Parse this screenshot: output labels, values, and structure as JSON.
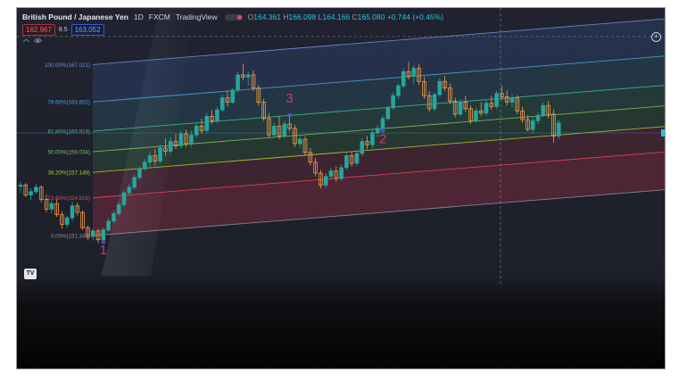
{
  "header": {
    "symbol": "British Pound / Japanese Yen",
    "interval": "1D",
    "source": "FXCM",
    "platform": "TradingView",
    "open_label": "O",
    "open": "164.361",
    "high_label": "H",
    "high": "166.098",
    "low_label": "L",
    "low": "164.166",
    "close_label": "C",
    "close": "165.080",
    "change": "+0.744 (+0.45%)"
  },
  "quote": {
    "bid": "162.967",
    "spread": "8.5",
    "ask": "163.052"
  },
  "icons": {
    "logo": "tradingview-logo-icon",
    "eye": "eye-icon",
    "add": "plus-circle-icon"
  },
  "logo_text": "TV",
  "colors": {
    "bull": "#26a69a",
    "bear": "#f09a4a",
    "wave_label": "#d6336c",
    "fib_100": "#6f8fd6",
    "fib_786": "#4aa3d6",
    "fib_618": "#3fbf8f",
    "fib_50": "#7cc05a",
    "fib_382": "#b6c43a",
    "fib_236": "#e8455a",
    "fib_0": "#8c8f99"
  },
  "chart_data": {
    "type": "candlestick",
    "y_unit": "JPY per GBP",
    "ylim": [
      147.6,
      171.8
    ],
    "fib_channel": {
      "levels": [
        {
          "ratio": "0.00%",
          "price": "151.349"
        },
        {
          "ratio": "23.60%",
          "price": "154.816"
        },
        {
          "ratio": "38.20%",
          "price": "157.149"
        },
        {
          "ratio": "50.00%",
          "price": "159.034"
        },
        {
          "ratio": "61.80%",
          "price": "160.919"
        },
        {
          "ratio": "78.60%",
          "price": "163.602"
        },
        {
          "ratio": "100.00%",
          "price": "167.021"
        }
      ],
      "slope_per_bar": 0.038
    },
    "wave_points": [
      {
        "label": "1",
        "bar": 16
      },
      {
        "label": "2",
        "bar": 70
      },
      {
        "label": "3",
        "bar": 52
      }
    ],
    "candles": [
      [
        155.8,
        156.2,
        155.2,
        155.9
      ],
      [
        155.9,
        156.1,
        154.8,
        155.0
      ],
      [
        155.0,
        155.6,
        154.5,
        155.3
      ],
      [
        155.3,
        156.0,
        155.1,
        155.7
      ],
      [
        155.7,
        155.9,
        154.3,
        154.6
      ],
      [
        154.6,
        155.0,
        153.4,
        153.7
      ],
      [
        153.7,
        154.5,
        153.3,
        154.2
      ],
      [
        154.2,
        154.6,
        153.0,
        153.2
      ],
      [
        153.2,
        153.5,
        151.9,
        152.3
      ],
      [
        152.3,
        153.1,
        152.0,
        152.9
      ],
      [
        152.9,
        154.4,
        152.6,
        154.0
      ],
      [
        154.0,
        154.3,
        153.1,
        153.4
      ],
      [
        153.4,
        153.6,
        151.8,
        152.0
      ],
      [
        152.0,
        152.2,
        150.9,
        151.2
      ],
      [
        151.2,
        151.9,
        150.8,
        151.7
      ],
      [
        151.7,
        151.9,
        150.6,
        150.9
      ],
      [
        150.9,
        152.0,
        150.7,
        151.8
      ],
      [
        151.8,
        152.9,
        151.6,
        152.6
      ],
      [
        152.6,
        153.6,
        152.4,
        153.3
      ],
      [
        153.3,
        154.4,
        153.1,
        154.1
      ],
      [
        154.1,
        155.4,
        153.9,
        155.2
      ],
      [
        155.2,
        156.0,
        155.0,
        155.7
      ],
      [
        155.7,
        156.9,
        155.5,
        156.6
      ],
      [
        156.6,
        157.6,
        156.4,
        157.4
      ],
      [
        157.4,
        158.3,
        157.2,
        158.0
      ],
      [
        158.0,
        158.9,
        157.6,
        158.6
      ],
      [
        158.6,
        159.2,
        157.7,
        158.1
      ],
      [
        158.1,
        159.6,
        157.9,
        159.3
      ],
      [
        159.3,
        160.2,
        158.6,
        159.0
      ],
      [
        159.0,
        160.3,
        158.8,
        159.9
      ],
      [
        159.9,
        160.6,
        159.2,
        159.5
      ],
      [
        159.5,
        160.9,
        159.3,
        160.6
      ],
      [
        160.6,
        161.0,
        159.4,
        159.7
      ],
      [
        159.7,
        160.9,
        159.4,
        160.5
      ],
      [
        160.5,
        161.6,
        160.2,
        161.3
      ],
      [
        161.3,
        162.0,
        160.6,
        160.9
      ],
      [
        160.9,
        162.5,
        160.7,
        162.2
      ],
      [
        162.2,
        162.8,
        161.5,
        161.8
      ],
      [
        161.8,
        163.1,
        161.6,
        162.8
      ],
      [
        162.8,
        164.2,
        162.6,
        163.9
      ],
      [
        163.9,
        164.5,
        163.1,
        163.5
      ],
      [
        163.5,
        164.8,
        163.3,
        164.6
      ],
      [
        164.6,
        166.3,
        164.4,
        166.0
      ],
      [
        166.0,
        167.0,
        165.5,
        165.8
      ],
      [
        165.8,
        166.3,
        165.0,
        166.0
      ],
      [
        166.0,
        166.4,
        164.5,
        164.8
      ],
      [
        164.8,
        165.1,
        163.2,
        163.5
      ],
      [
        163.5,
        163.8,
        161.8,
        162.0
      ],
      [
        162.0,
        162.5,
        160.2,
        160.5
      ],
      [
        160.5,
        161.6,
        160.3,
        161.3
      ],
      [
        161.3,
        162.2,
        160.1,
        160.4
      ],
      [
        160.4,
        161.8,
        160.2,
        161.5
      ],
      [
        161.5,
        162.3,
        160.8,
        161.1
      ],
      [
        161.1,
        161.4,
        159.4,
        159.7
      ],
      [
        159.7,
        160.4,
        159.3,
        160.1
      ],
      [
        160.1,
        160.4,
        158.6,
        158.9
      ],
      [
        158.9,
        159.3,
        157.7,
        158.0
      ],
      [
        158.0,
        158.4,
        156.7,
        157.0
      ],
      [
        157.0,
        157.3,
        155.6,
        155.9
      ],
      [
        155.9,
        157.0,
        155.6,
        156.7
      ],
      [
        156.7,
        157.5,
        156.4,
        157.2
      ],
      [
        157.2,
        157.6,
        156.2,
        156.5
      ],
      [
        156.5,
        157.8,
        156.3,
        157.5
      ],
      [
        157.5,
        158.9,
        157.3,
        158.6
      ],
      [
        158.6,
        159.0,
        157.6,
        157.9
      ],
      [
        157.9,
        159.1,
        157.6,
        158.8
      ],
      [
        158.8,
        160.2,
        158.5,
        159.9
      ],
      [
        159.9,
        160.4,
        159.2,
        159.6
      ],
      [
        159.6,
        161.0,
        159.3,
        160.7
      ],
      [
        160.7,
        161.4,
        160.3,
        161.1
      ],
      [
        161.1,
        162.3,
        160.9,
        162.0
      ],
      [
        162.0,
        163.2,
        161.8,
        163.0
      ],
      [
        163.0,
        164.4,
        162.8,
        164.1
      ],
      [
        164.1,
        165.2,
        163.8,
        165.0
      ],
      [
        165.0,
        166.6,
        164.8,
        166.3
      ],
      [
        166.3,
        167.2,
        165.6,
        165.9
      ],
      [
        165.9,
        166.9,
        165.2,
        166.6
      ],
      [
        166.6,
        167.0,
        165.1,
        165.4
      ],
      [
        165.4,
        165.8,
        163.8,
        164.1
      ],
      [
        164.1,
        164.5,
        162.6,
        162.9
      ],
      [
        162.9,
        164.4,
        162.6,
        164.2
      ],
      [
        164.2,
        165.7,
        164.0,
        165.4
      ],
      [
        165.4,
        165.9,
        164.5,
        164.8
      ],
      [
        164.8,
        165.2,
        163.3,
        163.6
      ],
      [
        163.6,
        163.9,
        162.1,
        162.4
      ],
      [
        162.4,
        163.8,
        162.2,
        163.5
      ],
      [
        163.5,
        164.1,
        162.6,
        162.9
      ],
      [
        162.9,
        163.2,
        161.5,
        161.8
      ],
      [
        161.8,
        163.0,
        161.6,
        162.7
      ],
      [
        162.7,
        163.5,
        162.2,
        162.5
      ],
      [
        162.5,
        163.7,
        162.3,
        163.4
      ],
      [
        163.4,
        164.1,
        162.8,
        163.1
      ],
      [
        163.1,
        164.5,
        162.9,
        164.3
      ],
      [
        164.3,
        165.0,
        163.7,
        164.0
      ],
      [
        164.0,
        164.6,
        163.2,
        163.5
      ],
      [
        163.5,
        164.2,
        163.0,
        163.9
      ],
      [
        163.9,
        164.1,
        162.4,
        162.7
      ],
      [
        162.7,
        163.1,
        161.6,
        161.9
      ],
      [
        161.9,
        162.3,
        160.8,
        161.0
      ],
      [
        161.0,
        162.2,
        160.6,
        161.8
      ],
      [
        161.8,
        162.6,
        161.5,
        162.3
      ],
      [
        162.3,
        163.5,
        162.1,
        163.2
      ],
      [
        163.2,
        163.6,
        162.0,
        162.4
      ],
      [
        162.4,
        162.8,
        159.8,
        160.4
      ],
      [
        160.4,
        161.9,
        160.1,
        161.6
      ]
    ]
  }
}
